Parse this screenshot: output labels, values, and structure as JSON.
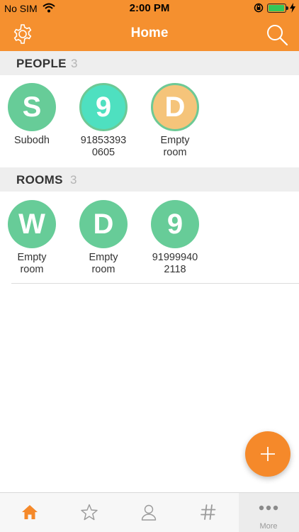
{
  "status_bar": {
    "carrier": "No SIM",
    "time": "2:00 PM"
  },
  "nav": {
    "title": "Home",
    "left_icon": "gear-icon",
    "right_icon": "search-icon"
  },
  "colors": {
    "brand": "#f5902f",
    "avatar_green": "#67cc98",
    "avatar_teal": "#4ee0c0",
    "avatar_orange": "#f5c47a"
  },
  "people": {
    "label": "PEOPLE",
    "count": "3",
    "items": [
      {
        "initial": "S",
        "name_line1": "Subodh",
        "name_line2": ""
      },
      {
        "initial": "9",
        "name_line1": "91853393",
        "name_line2": "0605"
      },
      {
        "initial": "D",
        "name_line1": "Empty",
        "name_line2": "room"
      }
    ]
  },
  "rooms": {
    "label": "ROOMS",
    "count": "3",
    "items": [
      {
        "initial": "W",
        "name_line1": "Empty",
        "name_line2": "room"
      },
      {
        "initial": "D",
        "name_line1": "Empty",
        "name_line2": "room"
      },
      {
        "initial": "9",
        "name_line1": "91999940",
        "name_line2": "2118"
      }
    ]
  },
  "fab": {
    "icon": "plus-icon"
  },
  "tabbar": {
    "tabs": [
      {
        "icon": "home-icon",
        "active": true
      },
      {
        "icon": "star-icon",
        "active": false
      },
      {
        "icon": "person-icon",
        "active": false
      },
      {
        "icon": "hashtag-icon",
        "active": false
      },
      {
        "icon": "more-icon",
        "label": "More",
        "active": false
      }
    ]
  }
}
